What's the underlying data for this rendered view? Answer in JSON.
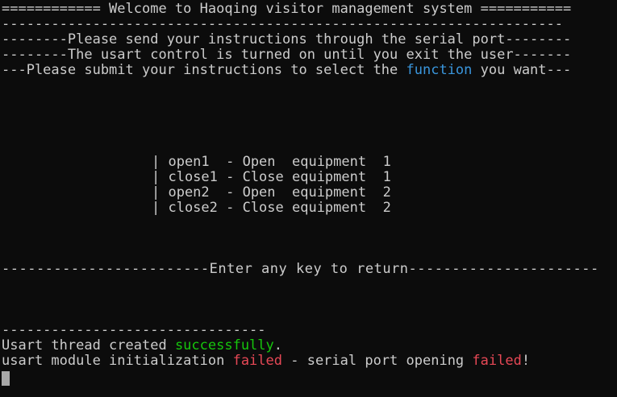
{
  "banner": {
    "title_line": "============ Welcome to Haoqing visitor management system ===========",
    "dash_line": "--------------------------------------------------------------------",
    "instr1": "--------Please send your instructions through the serial port--------",
    "instr2": "--------The usart control is turned on until you exit the user-------",
    "instr3_prefix": "---Please submit your instructions to select the ",
    "instr3_keyword": "function",
    "instr3_suffix": " you want---"
  },
  "menu": {
    "items": [
      "| open1  - Open  equipment  1",
      "| close1 - Close equipment  1",
      "| open2  - Open  equipment  2",
      "| close2 - Close equipment  2"
    ]
  },
  "return_line": "------------------------Enter any key to return----------------------",
  "log": {
    "separator": "--------------------------------",
    "line1_prefix": "Usart thread created ",
    "line1_status": "successfully",
    "line1_suffix": ".",
    "line2_prefix": "usart module initialization ",
    "line2_status": "failed",
    "line2_middle": " - serial port opening ",
    "line2_status2": "failed",
    "line2_suffix": "!"
  },
  "colors": {
    "background": "#0c0c0c",
    "text": "#cccccc",
    "keyword_blue": "#3a96dd",
    "success_green": "#16c60c",
    "error_red": "#e74856"
  }
}
